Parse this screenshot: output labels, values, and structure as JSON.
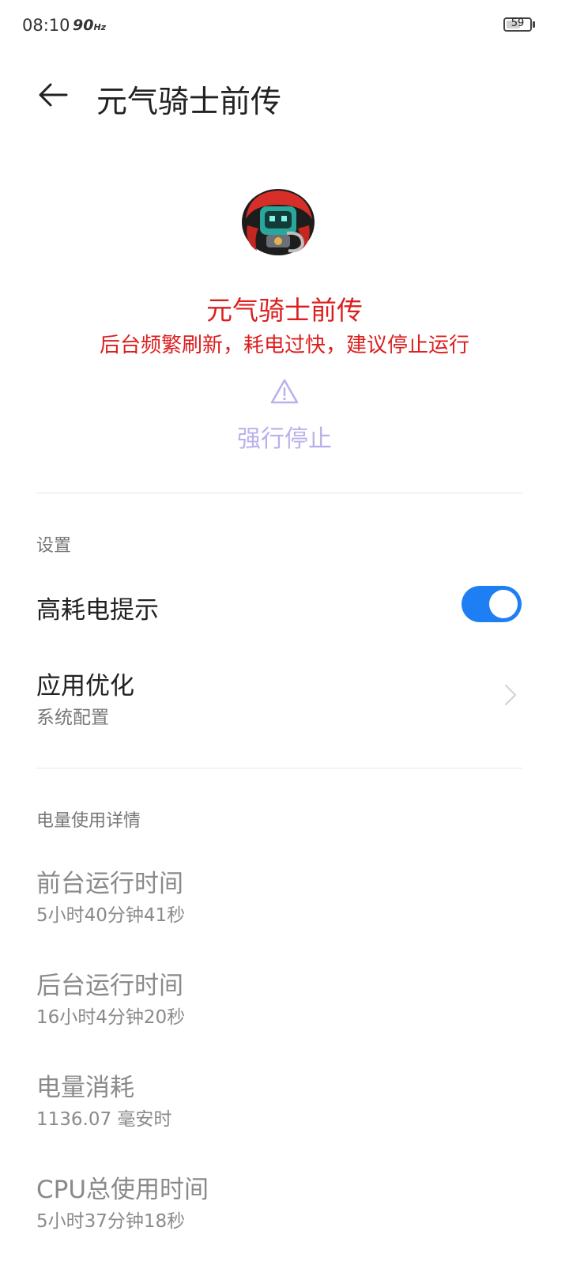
{
  "status_bar": {
    "time": "08:10",
    "refresh_rate": "90",
    "refresh_unit": "Hz",
    "battery_level": "59",
    "battery_fraction": 0.59
  },
  "header": {
    "title": "元气骑士前传",
    "back_icon": "arrow-left-icon"
  },
  "app": {
    "name": "元气骑士前传",
    "warning": "后台频繁刷新，耗电过快，建议停止运行",
    "force_stop_label": "强行停止",
    "force_stop_icon": "warning-triangle-icon"
  },
  "settings": {
    "section_label": "设置",
    "high_power_alert": {
      "label": "高耗电提示",
      "enabled": true
    },
    "app_optimization": {
      "label": "应用优化",
      "value": "系统配置"
    }
  },
  "usage": {
    "section_label": "电量使用详情",
    "items": [
      {
        "label": "前台运行时间",
        "value": "5小时40分钟41秒"
      },
      {
        "label": "后台运行时间",
        "value": "16小时4分钟20秒"
      },
      {
        "label": "电量消耗",
        "value": "1136.07 毫安时"
      },
      {
        "label": "CPU总使用时间",
        "value": "5小时37分钟18秒"
      }
    ]
  },
  "colors": {
    "warning_red": "#dd1e1e",
    "toggle_blue": "#1e7ff5",
    "disabled_purple": "#b9b1ec"
  }
}
